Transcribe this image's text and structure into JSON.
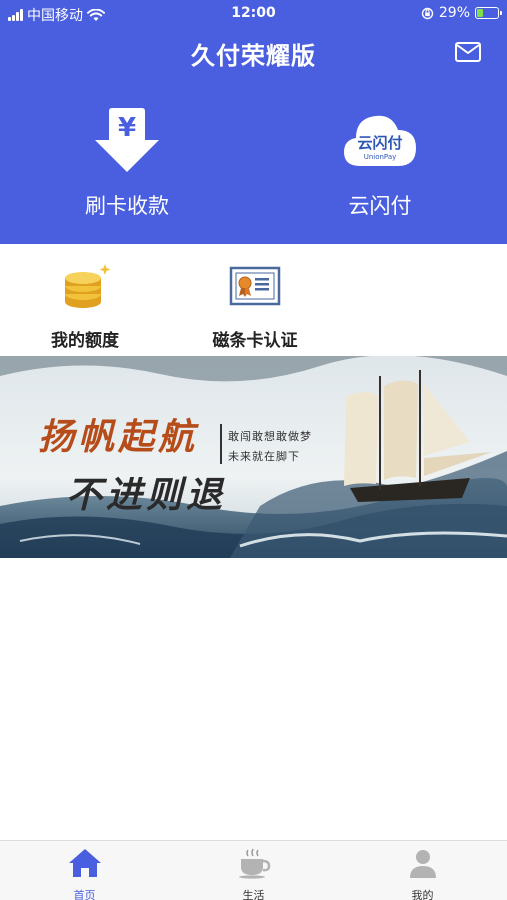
{
  "status_bar": {
    "carrier": "中国移动",
    "time": "12:00",
    "battery_percent": "29%",
    "battery_level": 0.29
  },
  "header": {
    "title": "久付荣耀版",
    "mail_icon": "mail-icon",
    "background": "#4a5fe0"
  },
  "quick_actions": [
    {
      "label": "刷卡收款",
      "icon": "yuan-download-icon"
    },
    {
      "label": "云闪付",
      "icon": "unionpay-cloud-icon",
      "logo_text": "云闪付",
      "logo_subtext": "UnionPay"
    }
  ],
  "features": [
    {
      "label": "我的额度",
      "icon": "coins-icon"
    },
    {
      "label": "磁条卡认证",
      "icon": "certificate-icon"
    }
  ],
  "banner": {
    "slogan_line1": "扬帆起航",
    "slogan_line2": "不进则退",
    "sub_line1": "敢闯敢想敢做梦",
    "sub_line2": "未来就在脚下"
  },
  "tabbar": {
    "accent": "#4a5fe0",
    "tabs": [
      {
        "label": "首页",
        "icon": "home-icon",
        "active": true
      },
      {
        "label": "生活",
        "icon": "coffee-cup-icon",
        "active": false
      },
      {
        "label": "我的",
        "icon": "user-icon",
        "active": false
      }
    ]
  }
}
